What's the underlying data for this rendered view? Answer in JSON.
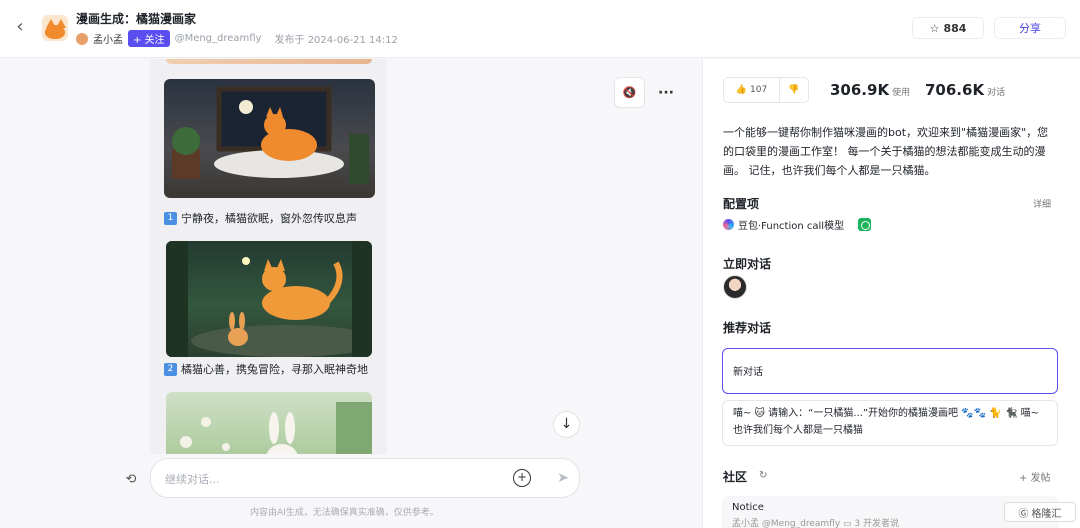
{
  "header": {
    "title": "漫画生成：橘猫漫画家",
    "author": "孟小孟",
    "follow_label": "+ 关注",
    "handle": "@Meng_dreamfly",
    "published": "发布于 2024-06-21 14:12",
    "star_count": "884",
    "share_label": "分享"
  },
  "chat": {
    "captions": [
      {
        "num": "1",
        "text": "宁静夜，橘猫欲眠，窗外忽传叹息声"
      },
      {
        "num": "2",
        "text": "橘猫心善，携兔冒险，寻那入眠神奇地"
      }
    ],
    "input_placeholder": "继续对话...",
    "disclaimer": "内容由AI生成，无法确保真实准确，仅供参考。"
  },
  "panel": {
    "likes": "107",
    "uses_value": "306.9K",
    "uses_label": "使用",
    "chats_value": "706.6K",
    "chats_label": "对话",
    "description": "一个能够一键帮你制作猫咪漫画的bot，欢迎来到\"橘猫漫画家\"，您的口袋里的漫画工作室！ 每一个关于橘猫的想法都能变成生动的漫画。 记住，也许我们每个人都是一只橘猫。",
    "config_title": "配置项",
    "detail_label": "详细",
    "model_label": "豆包·Function call模型",
    "instant_chat_title": "立即对话",
    "suggested_title": "推荐对话",
    "suggested": [
      "新对话",
      "喵~ 🐱 请输入：“一只橘猫...”开始你的橘猫漫画吧 🐾🐾 🐈 🐈‍⬛ 喵~也许我们每个人都是一只橘猫"
    ],
    "community_title": "社区",
    "post_label": "+ 发帖",
    "notice_title": "Notice",
    "notice_author": "孟小孟",
    "notice_handle": "@Meng_dreamfly",
    "notice_count": "3",
    "notice_tag": "开发者说"
  },
  "watermark": "格隆汇"
}
